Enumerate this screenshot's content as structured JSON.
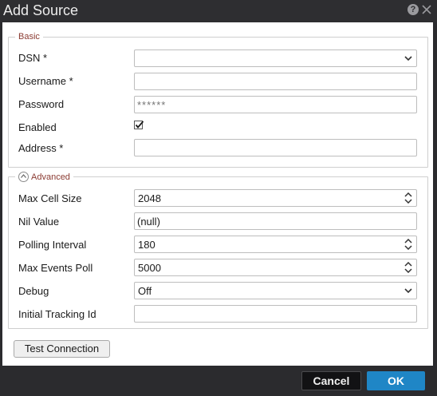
{
  "dialog": {
    "title": "Add Source"
  },
  "basic": {
    "legend": "Basic",
    "dsn_label": "DSN *",
    "dsn_value": "",
    "username_label": "Username *",
    "username_value": "",
    "password_label": "Password",
    "password_placeholder": "******",
    "enabled_label": "Enabled",
    "enabled_checked": true,
    "address_label": "Address *",
    "address_value": ""
  },
  "advanced": {
    "legend": "Advanced",
    "max_cell_size_label": "Max Cell Size",
    "max_cell_size_value": "2048",
    "nil_value_label": "Nil Value",
    "nil_value_value": "(null)",
    "polling_interval_label": "Polling Interval",
    "polling_interval_value": "180",
    "max_events_poll_label": "Max Events Poll",
    "max_events_poll_value": "5000",
    "debug_label": "Debug",
    "debug_value": "Off",
    "initial_tracking_id_label": "Initial Tracking Id",
    "initial_tracking_id_value": ""
  },
  "buttons": {
    "test_connection": "Test Connection",
    "cancel": "Cancel",
    "ok": "OK"
  },
  "colors": {
    "title_bar": "#2e2e31",
    "legend_text": "#8b3b32",
    "ok_button": "#1f86c6",
    "cancel_button": "#121214"
  },
  "icons": [
    "help-icon",
    "close-icon",
    "chevron-down-icon",
    "spinner-icon",
    "checkmark-icon",
    "collapse-icon"
  ]
}
